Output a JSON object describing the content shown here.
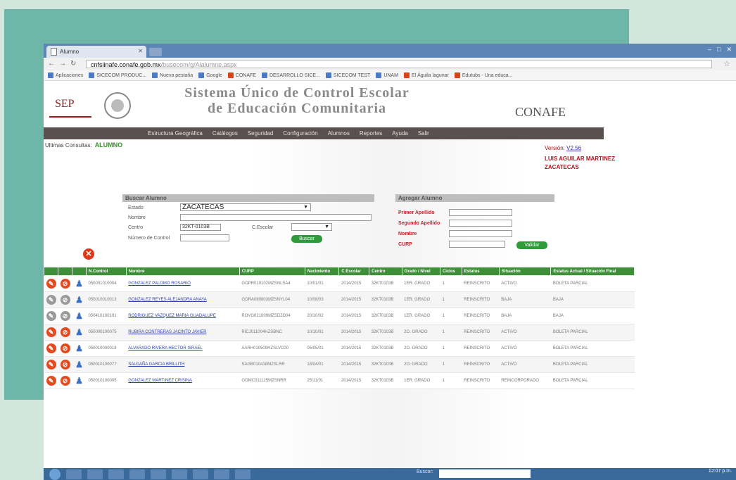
{
  "browser": {
    "tab_title": "Alumno",
    "url_host": "cnfsiinafe.conafe.gob.mx",
    "url_path": "/busecom/g/Alalumne.aspx"
  },
  "bookmarks": [
    "Aplicaciones",
    "SICECOM PRODUC...",
    "Nueva pestaña",
    "Google",
    "CONAFE",
    "DESARROLLO SICE...",
    "SICECOM TEST",
    "UNAM",
    "El Águila lagunar",
    "Edutubs - Una educa..."
  ],
  "header": {
    "sep": "SEP",
    "system_line1": "Sistema Único de Control Escolar",
    "system_line2": "de Educación Comunitaria",
    "logo": "CONAFE"
  },
  "menu": [
    "Estructura Geográfica",
    "Catálogos",
    "Seguridad",
    "Configuración",
    "Alumnos",
    "Reportes",
    "Ayuda",
    "Salir"
  ],
  "ultimas": {
    "label": "Ultimas Consultas:",
    "value": "ALUMNO"
  },
  "user": {
    "version_label": "Versión:",
    "version": "V2.56",
    "name": "LUIS AGUILAR MARTINEZ",
    "state": "ZACATECAS"
  },
  "buscar": {
    "title": "Buscar Alumno",
    "estado_label": "Estado",
    "estado_value": "ZACATECAS",
    "nombre_label": "Nombre",
    "centro_label": "Centro",
    "centro_value": "32KT-0103B",
    "czona_label": "C.Escolar",
    "control_label": "Número de Control",
    "button": "Buscar"
  },
  "agregar": {
    "title": "Agregar Alumno",
    "ap1": "Primer Apellido",
    "ap2": "Segundo Apellido",
    "nombre": "Nombre",
    "curp": "CURP",
    "button": "Validar"
  },
  "table": {
    "headers": [
      "N.Control",
      "Nombre",
      "CURP",
      "Nacimiento",
      "C.Escolar",
      "Centro",
      "Grado / Nivel",
      "Ciclos",
      "Estatus",
      "Situación",
      "Estatus Actual / Situación Final"
    ],
    "rows": [
      {
        "c": "050001010004",
        "n": "GONZALEZ PALOMO ROSARIO",
        "curp": "GOPR010102MZSNLSA4",
        "nac": "10/01/01",
        "z": "2014/2015",
        "ce": "32KT0103B",
        "g": "1ER. GRADO",
        "ci": "1",
        "e": "REINSCRITO",
        "s": "ACTIVO",
        "f": "BOLETA PARCIAL",
        "inact": false
      },
      {
        "c": "050010010013",
        "n": "GONZALEZ REYES ALEJANDRA ANAYA",
        "curp": "GORA080803MZSNYL04",
        "nac": "10/08/03",
        "z": "2014/2015",
        "ce": "32KT0103B",
        "g": "1ER. GRADO",
        "ci": "1",
        "e": "REINSCRITO",
        "s": "BAJA",
        "f": "BAJA",
        "inact": true
      },
      {
        "c": "050410100101",
        "n": "RODRIGUEZ VAZQUEZ MARIA GUADALUPE",
        "curp": "ROVG021009MZSDZD04",
        "nac": "20/10/02",
        "z": "2014/2015",
        "ce": "32KT0103B",
        "g": "1ER. GRADO",
        "ci": "1",
        "e": "REINSCRITO",
        "s": "BAJA",
        "f": "BAJA",
        "inact": true
      },
      {
        "c": "050000100075",
        "n": "RUBIRA CONTRERAS JACINTO JAVIER",
        "curp": "RICJ011004HZSBNC",
        "nac": "10/10/01",
        "z": "2014/2015",
        "ce": "32KT0103B",
        "g": "2O. GRADO",
        "ci": "1",
        "e": "REINSCRITO",
        "s": "ACTIVO",
        "f": "BOLETA PARCIAL",
        "inact": false
      },
      {
        "c": "050010000018",
        "n": "ALVARADO RIVERA HECTOR ISRAEL",
        "curp": "AARH010509HZSLVC00",
        "nac": "05/05/01",
        "z": "2014/2015",
        "ce": "32KT0103B",
        "g": "2O. GRADO",
        "ci": "1",
        "e": "REINSCRITO",
        "s": "ACTIVO",
        "f": "BOLETA PARCIAL",
        "inact": false
      },
      {
        "c": "050010100077",
        "n": "SALDAÑA GARCIA BRILLITH",
        "curp": "SAGB010418MZSLRR",
        "nac": "18/04/01",
        "z": "2014/2015",
        "ce": "32KT0103B",
        "g": "2O. GRADO",
        "ci": "1",
        "e": "REINSCRITO",
        "s": "ACTIVO",
        "f": "BOLETA PARCIAL",
        "inact": false
      },
      {
        "c": "050010100005",
        "n": "GONZALEZ MARTINEZ CRISINA",
        "curp": "GOMC011125MZSNRR",
        "nac": "25/11/01",
        "z": "2014/2015",
        "ce": "32KT0103B",
        "g": "1ER. GRADO",
        "ci": "1",
        "e": "REINSCRITO",
        "s": "REINCORPORADO",
        "f": "BOLETA PARCIAL",
        "inact": false
      }
    ]
  },
  "taskbar": {
    "buscar": "Buscar:",
    "time": "12:07 p.m."
  },
  "colors": {
    "teal": "#6db6a8",
    "menu": "#5a5050",
    "table_header": "#3f8f3a",
    "accent_red": "#b3121e",
    "button_green": "#2f9a3a"
  }
}
